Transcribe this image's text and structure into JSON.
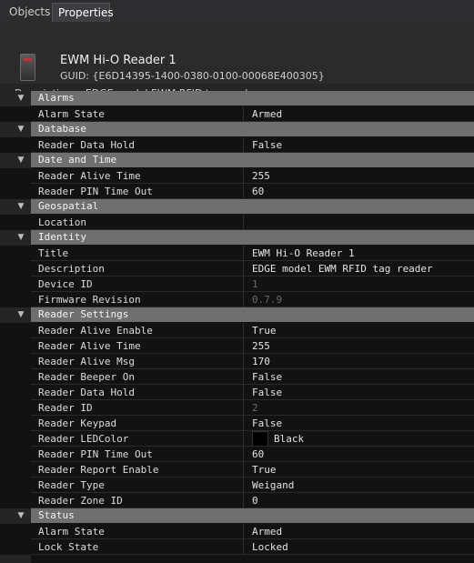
{
  "tabs": [
    {
      "label": "Objects",
      "active": false
    },
    {
      "label": "Properties",
      "active": true
    }
  ],
  "header": {
    "icon": "card-reader-icon",
    "title": "EWM Hi-O Reader 1",
    "guid_label": "GUID:",
    "guid": "{E6D14395-1400-0380-0100-00068E400305}",
    "description_label": "Description:",
    "description": "EDGE model EWM RFID tag reader"
  },
  "colors": {
    "background": "#252526",
    "grid": "#121212",
    "category_bar": "#6f6f6f",
    "readonly_text": "#6a6a6a",
    "led_color_swatch": "#000000"
  },
  "grid": [
    {
      "type": "category",
      "label": "Alarms"
    },
    {
      "type": "prop",
      "name": "Alarm State",
      "value": "Armed"
    },
    {
      "type": "category",
      "label": "Database"
    },
    {
      "type": "prop",
      "name": "Reader Data Hold",
      "value": "False"
    },
    {
      "type": "category",
      "label": "Date and Time"
    },
    {
      "type": "prop",
      "name": "Reader Alive Time",
      "value": "255"
    },
    {
      "type": "prop",
      "name": "Reader PIN Time Out",
      "value": "60"
    },
    {
      "type": "category",
      "label": "Geospatial"
    },
    {
      "type": "prop",
      "name": "Location",
      "value": ""
    },
    {
      "type": "category",
      "label": "Identity"
    },
    {
      "type": "prop",
      "name": "Title",
      "value": "EWM Hi-O Reader 1"
    },
    {
      "type": "prop",
      "name": "Description",
      "value": "EDGE model EWM RFID tag reader"
    },
    {
      "type": "prop",
      "name": "Device ID",
      "value": "1",
      "readonly": true
    },
    {
      "type": "prop",
      "name": "Firmware Revision",
      "value": "0.7.9",
      "readonly": true
    },
    {
      "type": "category",
      "label": "Reader Settings"
    },
    {
      "type": "prop",
      "name": "Reader Alive Enable",
      "value": "True"
    },
    {
      "type": "prop",
      "name": "Reader Alive Time",
      "value": "255"
    },
    {
      "type": "prop",
      "name": "Reader Alive Msg",
      "value": "170"
    },
    {
      "type": "prop",
      "name": "Reader Beeper On",
      "value": "False"
    },
    {
      "type": "prop",
      "name": "Reader Data Hold",
      "value": "False"
    },
    {
      "type": "prop",
      "name": "Reader ID",
      "value": "2",
      "readonly": true
    },
    {
      "type": "prop",
      "name": "Reader Keypad",
      "value": "False"
    },
    {
      "type": "prop",
      "name": "Reader LEDColor",
      "value": "Black",
      "swatch": true
    },
    {
      "type": "prop",
      "name": "Reader PIN Time Out",
      "value": "60"
    },
    {
      "type": "prop",
      "name": "Reader Report Enable",
      "value": "True"
    },
    {
      "type": "prop",
      "name": "Reader Type",
      "value": "Weigand"
    },
    {
      "type": "prop",
      "name": "Reader Zone ID",
      "value": "0"
    },
    {
      "type": "category",
      "label": "Status"
    },
    {
      "type": "prop",
      "name": "Alarm State",
      "value": "Armed"
    },
    {
      "type": "prop",
      "name": "Lock State",
      "value": "Locked"
    }
  ]
}
